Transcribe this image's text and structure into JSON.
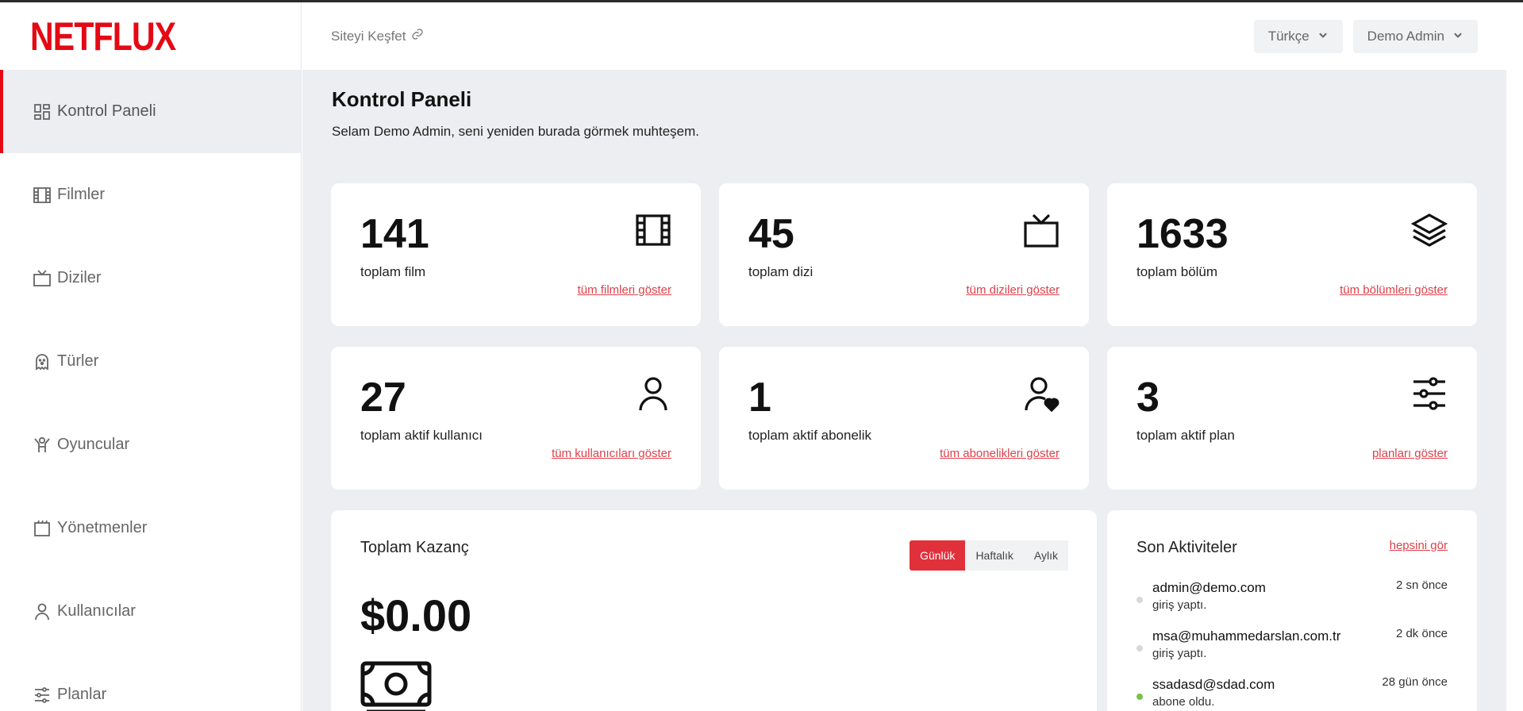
{
  "brand": {
    "logo": "NETFLUX",
    "accent": "#e50914"
  },
  "sidebar": {
    "items": [
      {
        "label": "Kontrol Paneli",
        "icon": "dashboard-icon",
        "active": true
      },
      {
        "label": "Filmler",
        "icon": "film-icon"
      },
      {
        "label": "Diziler",
        "icon": "tv-icon"
      },
      {
        "label": "Türler",
        "icon": "ghost-icon"
      },
      {
        "label": "Oyuncular",
        "icon": "actor-icon"
      },
      {
        "label": "Yönetmenler",
        "icon": "clapperboard-icon"
      },
      {
        "label": "Kullanıcılar",
        "icon": "user-icon"
      },
      {
        "label": "Planlar",
        "icon": "sliders-icon"
      }
    ]
  },
  "topbar": {
    "discover_label": "Siteyi Keşfet",
    "language": "Türkçe",
    "user": "Demo Admin"
  },
  "main": {
    "title": "Kontrol Paneli",
    "welcome": "Selam Demo Admin, seni yeniden burada görmek muhteşem."
  },
  "stats": [
    {
      "value": "141",
      "label": "toplam film",
      "link": "tüm filmleri göster",
      "icon": "film-icon"
    },
    {
      "value": "45",
      "label": "toplam dizi",
      "link": "tüm dizileri göster",
      "icon": "tv-icon"
    },
    {
      "value": "1633",
      "label": "toplam bölüm",
      "link": "tüm bölümleri göster",
      "icon": "layers-icon"
    },
    {
      "value": "27",
      "label": "toplam aktif kullanıcı",
      "link": "tüm kullanıcıları göster",
      "icon": "user-icon"
    },
    {
      "value": "1",
      "label": "toplam aktif abonelik",
      "link": "tüm abonelikleri göster",
      "icon": "user-heart-icon"
    },
    {
      "value": "3",
      "label": "toplam aktif plan",
      "link": "planları göster",
      "icon": "sliders-icon"
    }
  ],
  "earnings": {
    "title": "Toplam Kazanç",
    "tabs": [
      "Günlük",
      "Haftalık",
      "Aylık"
    ],
    "active_tab": "Günlük",
    "amount": "$0.00",
    "icon": "money-icon"
  },
  "activities": {
    "title": "Son Aktiviteler",
    "see_all": "hepsini gör",
    "items": [
      {
        "email": "admin@demo.com",
        "action": "giriş yaptı.",
        "time": "2 sn önce",
        "status": "grey"
      },
      {
        "email": "msa@muhammedarslan.com.tr",
        "action": "giriş yaptı.",
        "time": "2 dk önce",
        "status": "grey"
      },
      {
        "email": "ssadasd@sdad.com",
        "action": "abone oldu.",
        "time": "28 gün önce",
        "status": "green"
      }
    ]
  }
}
